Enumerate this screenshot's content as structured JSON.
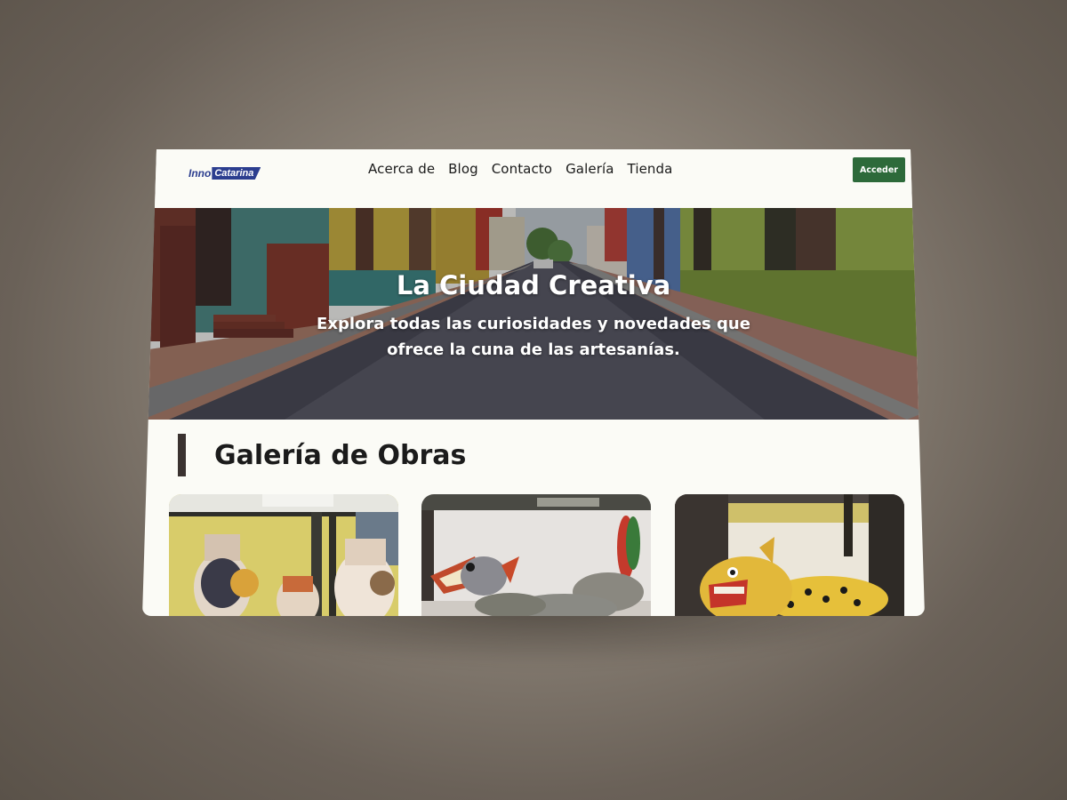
{
  "header": {
    "logo": {
      "part1": "Inno",
      "part2": "Catarina"
    },
    "nav": [
      {
        "label": "Acerca de"
      },
      {
        "label": "Blog"
      },
      {
        "label": "Contacto"
      },
      {
        "label": "Galería"
      },
      {
        "label": "Tienda"
      }
    ],
    "access_button": "Acceder"
  },
  "hero": {
    "title": "La Ciudad Creativa",
    "subtitle": "Explora todas las curiosidades y novedades que ofrece la cuna de las artesanías."
  },
  "gallery": {
    "title": "Galería de Obras"
  },
  "colors": {
    "brand_blue": "#2c3e8f",
    "button_green": "#2d6a3a",
    "page_bg": "#fbfbf6"
  }
}
